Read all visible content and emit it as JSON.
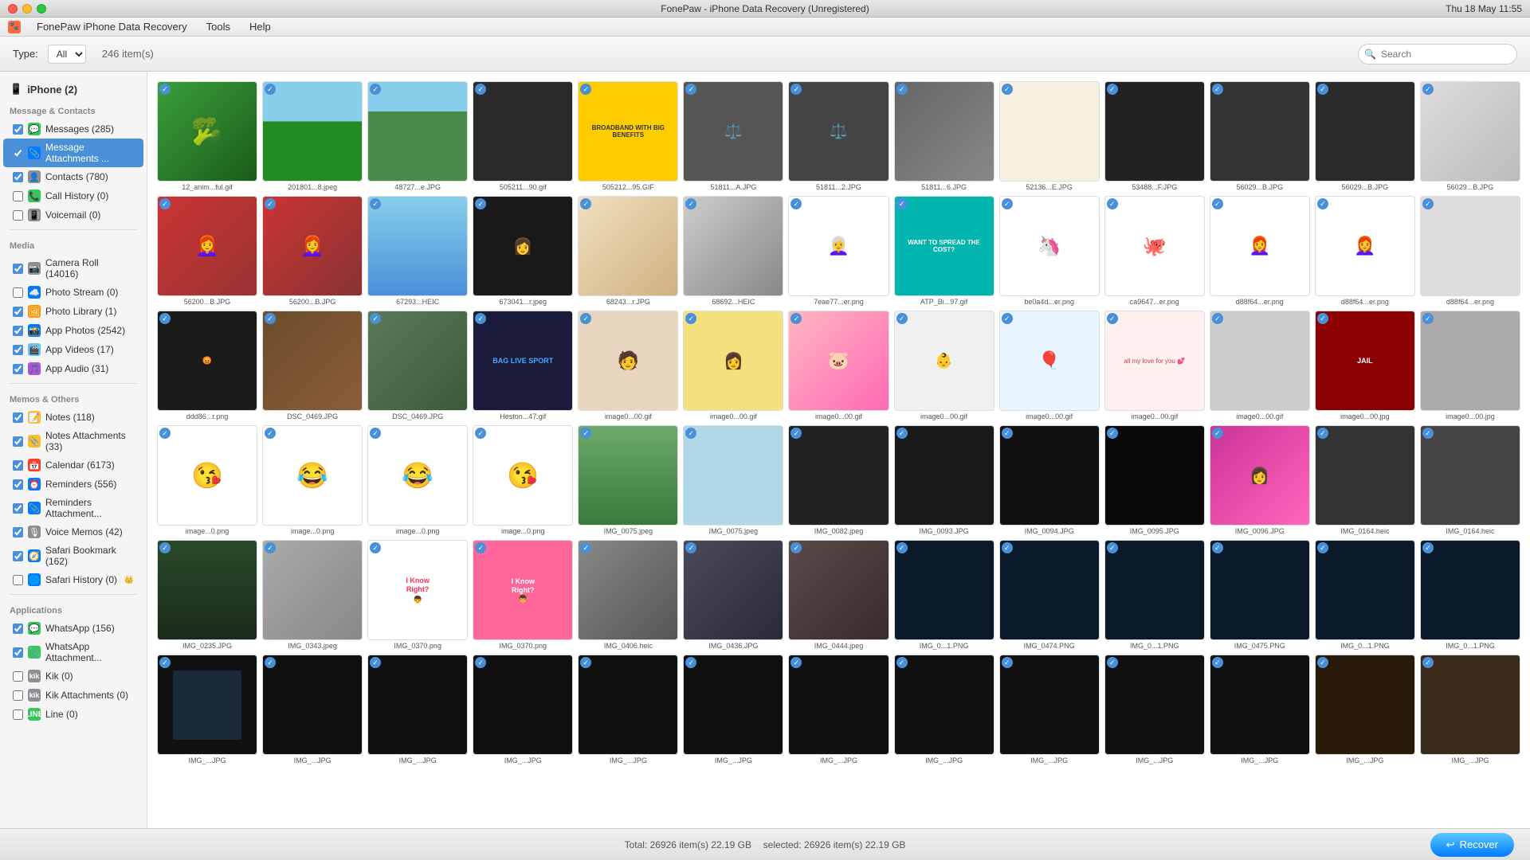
{
  "titleBar": {
    "title": "FonePaw - iPhone Data Recovery (Unregistered)",
    "appName": "FonePaw iPhone Data Recovery",
    "menuItems": [
      "FonePaw iPhone Data Recovery",
      "Tools",
      "Help"
    ],
    "time": "Thu 18 May  11:55"
  },
  "toolbar": {
    "typeLabel": "Type:",
    "typeValue": "All",
    "itemCount": "246 item(s)",
    "searchPlaceholder": "Search"
  },
  "sidebar": {
    "deviceLabel": "iPhone (2)",
    "sections": [
      {
        "title": "Message & Contacts",
        "items": [
          {
            "label": "Messages (285)",
            "icon": "💬",
            "iconColor": "green",
            "checked": true
          },
          {
            "label": "Message Attachments ...",
            "icon": "📎",
            "iconColor": "blue",
            "checked": true,
            "active": true
          },
          {
            "label": "Contacts (780)",
            "icon": "👤",
            "iconColor": "gray",
            "checked": true
          },
          {
            "label": "Call History (0)",
            "icon": "📞",
            "iconColor": "green",
            "checked": false
          },
          {
            "label": "Voicemail (0)",
            "icon": "📳",
            "iconColor": "gray",
            "checked": false
          }
        ]
      },
      {
        "title": "Media",
        "items": [
          {
            "label": "Camera Roll (14016)",
            "icon": "📷",
            "iconColor": "gray",
            "checked": true
          },
          {
            "label": "Photo Stream (0)",
            "icon": "🌊",
            "iconColor": "blue",
            "checked": false
          },
          {
            "label": "Photo Library (1)",
            "icon": "🖼",
            "iconColor": "orange",
            "checked": true
          },
          {
            "label": "App Photos (2542)",
            "icon": "📸",
            "iconColor": "blue",
            "checked": true
          },
          {
            "label": "App Videos (17)",
            "icon": "🎬",
            "iconColor": "teal",
            "checked": true
          },
          {
            "label": "App Audio (31)",
            "icon": "🎵",
            "iconColor": "purple",
            "checked": true
          }
        ]
      },
      {
        "title": "Memos & Others",
        "items": [
          {
            "label": "Notes (118)",
            "icon": "📝",
            "iconColor": "yellow",
            "checked": true
          },
          {
            "label": "Notes Attachments (33)",
            "icon": "📎",
            "iconColor": "yellow",
            "checked": true
          },
          {
            "label": "Calendar (6173)",
            "icon": "📅",
            "iconColor": "red",
            "checked": true
          },
          {
            "label": "Reminders (556)",
            "icon": "⏰",
            "iconColor": "blue",
            "checked": true
          },
          {
            "label": "Reminders Attachment...",
            "icon": "📎",
            "iconColor": "blue",
            "checked": true
          },
          {
            "label": "Voice Memos (42)",
            "icon": "🎙",
            "iconColor": "gray",
            "checked": true
          },
          {
            "label": "Safari Bookmark (162)",
            "icon": "🧭",
            "iconColor": "blue",
            "checked": true
          },
          {
            "label": "Safari History (0)",
            "icon": "🌐",
            "iconColor": "blue",
            "checked": false,
            "crown": true
          }
        ]
      },
      {
        "title": "Applications",
        "items": [
          {
            "label": "WhatsApp (156)",
            "icon": "💬",
            "iconColor": "green",
            "checked": true
          },
          {
            "label": "WhatsApp Attachment...",
            "icon": "📎",
            "iconColor": "green",
            "checked": true
          },
          {
            "label": "Kik (0)",
            "icon": "K",
            "iconColor": "gray",
            "checked": false
          },
          {
            "label": "Kik Attachments (0)",
            "icon": "K",
            "iconColor": "gray",
            "checked": false
          },
          {
            "label": "Line (0)",
            "icon": "L",
            "iconColor": "green",
            "checked": false
          }
        ]
      }
    ]
  },
  "photos": [
    {
      "label": "12_anim...ful.gif",
      "type": "broccoli"
    },
    {
      "label": "201801...8.jpeg",
      "type": "landscape"
    },
    {
      "label": "48727...e.JPG",
      "type": "landscape2"
    },
    {
      "label": "505211...90.gif",
      "type": "dark"
    },
    {
      "label": "505212...95.GIF",
      "type": "yellow-ad"
    },
    {
      "label": "51811...A.JPG",
      "type": "scale"
    },
    {
      "label": "51811...2.JPG",
      "type": "scale2"
    },
    {
      "label": "51811...6.JPG",
      "type": "car"
    },
    {
      "label": "52136...E.JPG",
      "type": "notebook"
    },
    {
      "label": "53488...F.JPG",
      "type": "collage"
    },
    {
      "label": "56029...B.JPG",
      "type": "dark-round"
    },
    {
      "label": "56029...B.JPG",
      "type": "dark-round2"
    },
    {
      "label": "56200...B.JPG",
      "type": "person-red"
    },
    {
      "label": "56200...B.JPG",
      "type": "person-red2"
    },
    {
      "label": "67293...HEIC",
      "type": "waterfall"
    },
    {
      "label": "673041...r.jpeg",
      "type": "person-dark"
    },
    {
      "label": "68243...r.JPG",
      "type": "shop"
    },
    {
      "label": "68692...HEIC",
      "type": "street"
    },
    {
      "label": "7eae77...er.png",
      "type": "avatar-glasses"
    },
    {
      "label": "ATP_Bi...97.gif",
      "type": "teal-circle"
    },
    {
      "label": "be0a4d...er.png",
      "type": "unicorn"
    },
    {
      "label": "ca9647...er.png",
      "type": "octopus"
    },
    {
      "label": "d88f64...er.png",
      "type": "woman-glasses"
    },
    {
      "label": "d88f64...er.png",
      "type": "woman-glasses2"
    },
    {
      "label": "ddd86...r.png",
      "type": "person-dark2"
    },
    {
      "label": "DSC_0469.JPG",
      "type": "outdoor"
    },
    {
      "label": "DSC_0469.JPG",
      "type": "outdoor2"
    },
    {
      "label": "Heston...47.gif",
      "type": "sport"
    },
    {
      "label": "image0...00.gif",
      "type": "michael"
    },
    {
      "label": "image0...00.gif",
      "type": "yellow-shirt"
    },
    {
      "label": "image0...00.gif",
      "type": "pig"
    },
    {
      "label": "image0...00.gif",
      "type": "baby"
    },
    {
      "label": "image0...00.gif",
      "type": "balloon"
    },
    {
      "label": "image0...00.gif",
      "type": "letter"
    },
    {
      "label": "image0...00.gif",
      "type": "jail"
    },
    {
      "label": "image0...00.gif",
      "type": "image-misc1"
    },
    {
      "label": "image0...0.png",
      "type": "emoji-kiss"
    },
    {
      "label": "image0...0.png",
      "type": "emoji-laugh"
    },
    {
      "label": "image0...0.png",
      "type": "emoji-laugh2"
    },
    {
      "label": "image0...0.png",
      "type": "emoji-kiss2"
    },
    {
      "label": "IMG_0075.jpeg",
      "type": "green-tree"
    },
    {
      "label": "IMG_0075.jpeg",
      "type": "map-blue"
    },
    {
      "label": "IMG_0082.jpeg",
      "type": "ultrasound"
    },
    {
      "label": "IMG_0093.JPG",
      "type": "photo-collage"
    },
    {
      "label": "IMG_0094.JPG",
      "type": "screen-dark"
    },
    {
      "label": "IMG_0095.JPG",
      "type": "screen-dark2"
    },
    {
      "label": "IMG_0096.JPG",
      "type": "woman-pink"
    },
    {
      "label": "IMG_0164.heic",
      "type": "image-misc2"
    },
    {
      "label": "IMG_0235.JPG",
      "type": "room-dark"
    },
    {
      "label": "IMG_0343.jpeg",
      "type": "corridor"
    },
    {
      "label": "IMG_0370.png",
      "type": "know-right-pink"
    },
    {
      "label": "IMG_0370.png",
      "type": "know-right-pink2"
    },
    {
      "label": "IMG_0406.heic",
      "type": "train"
    },
    {
      "label": "IMG_0436.JPG",
      "type": "architecture"
    },
    {
      "label": "IMG_0444.jpeg",
      "type": "architecture2"
    },
    {
      "label": "IMG_0...1.PNG",
      "type": "screenshot1"
    },
    {
      "label": "IMG_0474.PNG",
      "type": "screenshot2"
    },
    {
      "label": "IMG_0...1.PNG",
      "type": "screenshot3"
    },
    {
      "label": "IMG_0475.PNG",
      "type": "screenshot4"
    },
    {
      "label": "IMG_0...1.PNG",
      "type": "screenshot5"
    },
    {
      "label": "IMG_...JPG",
      "type": "screen-tiles1"
    },
    {
      "label": "IMG_...JPG",
      "type": "screen-tiles2"
    },
    {
      "label": "IMG_...JPG",
      "type": "screen-tiles3"
    },
    {
      "label": "IMG_...JPG",
      "type": "screen-tiles4"
    },
    {
      "label": "IMG_...JPG",
      "type": "screen-tiles5"
    },
    {
      "label": "IMG_...JPG",
      "type": "screen-tiles6"
    },
    {
      "label": "IMG_...JPG",
      "type": "screen-tiles7"
    },
    {
      "label": "IMG_...JPG",
      "type": "screen-tiles8"
    },
    {
      "label": "IMG_...JPG",
      "type": "screen-tiles9"
    }
  ],
  "bottomBar": {
    "totalLabel": "Total: 26926 item(s) 22.19 GB",
    "selectedLabel": "selected: 26926 item(s) 22.19 GB",
    "recoverButton": "Recover"
  }
}
